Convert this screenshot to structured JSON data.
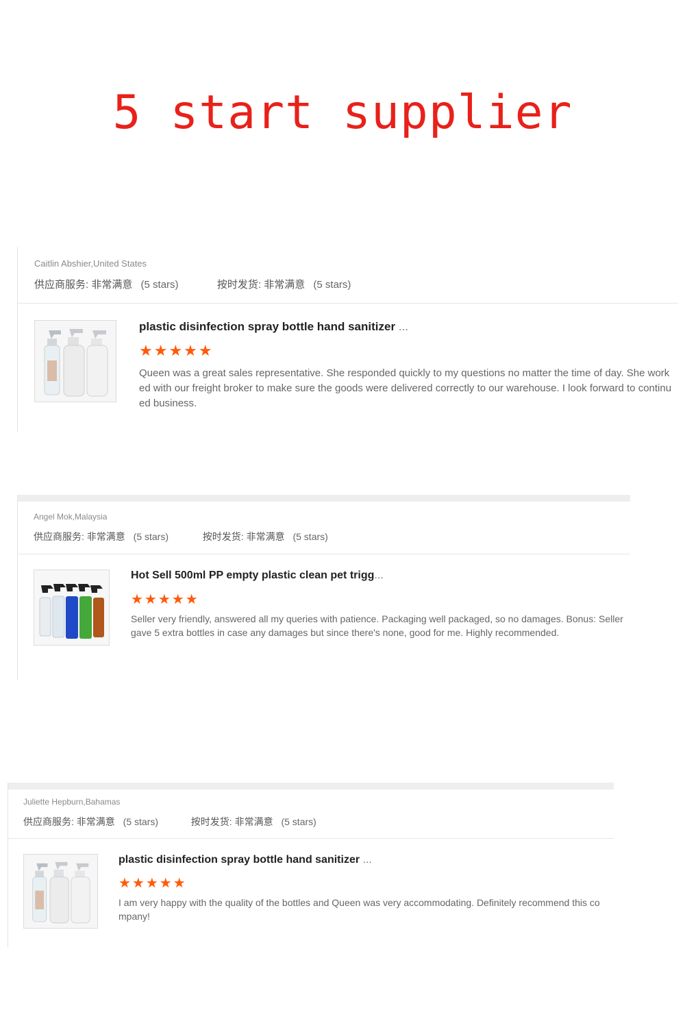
{
  "banner": {
    "text": "5 start supplier",
    "color": "#e8211a"
  },
  "theme": {
    "star_color": "#ff5a0a"
  },
  "reviews": [
    {
      "reviewer": "Caitlin Abshier,United States",
      "supplier_service_label": "供应商服务:",
      "supplier_service_value": "非常满意",
      "supplier_service_stars": "(5 stars)",
      "delivery_label": "按时发货:",
      "delivery_value": "非常满意",
      "delivery_stars": "(5 stars)",
      "product_title": "plastic disinfection spray bottle hand sanitizer",
      "ellipsis": "...",
      "rating": 5,
      "stars": "★★★★★",
      "thumbnail_icon": "spray-bottles-image",
      "review_text": "Queen was a great sales representative. She responded quickly to my questions no matter the time of day. She worked with our freight broker to make sure the goods were delivered correctly to our warehouse. I look forward to continued business."
    },
    {
      "reviewer": "Angel Mok,Malaysia",
      "supplier_service_label": "供应商服务:",
      "supplier_service_value": "非常满意",
      "supplier_service_stars": "(5 stars)",
      "delivery_label": "按时发货:",
      "delivery_value": "非常满意",
      "delivery_stars": "(5 stars)",
      "product_title": "Hot Sell 500ml PP empty plastic clean pet trigg",
      "ellipsis": "...",
      "rating": 5,
      "stars": "★★★★★",
      "thumbnail_icon": "colored-trigger-bottles-image",
      "review_text": "Seller very friendly, answered all my queries with patience. Packaging well packaged, so no damages. Bonus: Seller gave 5 extra bottles in case any damages but since there's none, good for me. Highly recommended."
    },
    {
      "reviewer": "Juliette Hepburn,Bahamas",
      "supplier_service_label": "供应商服务:",
      "supplier_service_value": "非常满意",
      "supplier_service_stars": "(5 stars)",
      "delivery_label": "按时发货:",
      "delivery_value": "非常满意",
      "delivery_stars": "(5 stars)",
      "product_title": "plastic disinfection spray bottle hand sanitizer",
      "ellipsis": "...",
      "rating": 5,
      "stars": "★★★★★",
      "thumbnail_icon": "spray-bottles-image",
      "review_text": "I am very happy with the quality of the bottles and Queen was very accommodating. Definitely recommend this company!"
    }
  ]
}
